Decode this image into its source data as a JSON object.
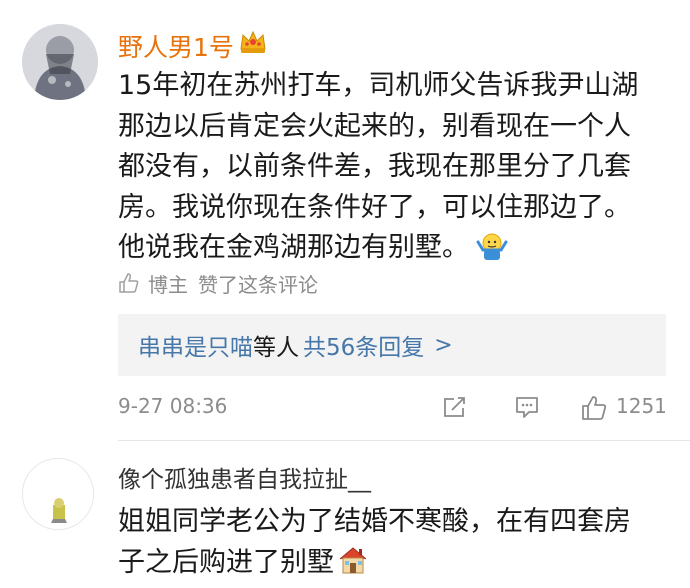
{
  "comments": [
    {
      "username": "野人男1号",
      "badge_icon": "crown-icon",
      "content_lines": [
        "15年初在苏州打车，司机师父告诉我尹山湖",
        "那边以后肯定会火起来的，别看现在一个人",
        "都没有，以前条件差，我现在那里分了几套",
        "房。我说你现在条件好了，可以住那边了。",
        "他说我在金鸡湖那边有别墅。"
      ],
      "trailing_emoji": "shrug-emoji-icon",
      "liked_by_label": "博主",
      "liked_text": "赞了这条评论",
      "reply_summary": {
        "users": "串串是只喵",
        "middle": "等人",
        "count_text": "共56条回复",
        "chevron": ">"
      },
      "timestamp": "9-27 08:36",
      "like_count": "1251"
    },
    {
      "username": "像个孤独患者自我拉扯__",
      "content_lines": [
        "姐姐同学老公为了结婚不寒酸，在有四套房",
        "子之后购进了别墅"
      ],
      "trailing_emoji": "house-emoji-icon"
    }
  ],
  "colors": {
    "username_highlight": "#e8730c",
    "link_blue": "#4677a8",
    "meta_gray": "#8c8c8c",
    "reply_bg": "#f3f3f3"
  }
}
